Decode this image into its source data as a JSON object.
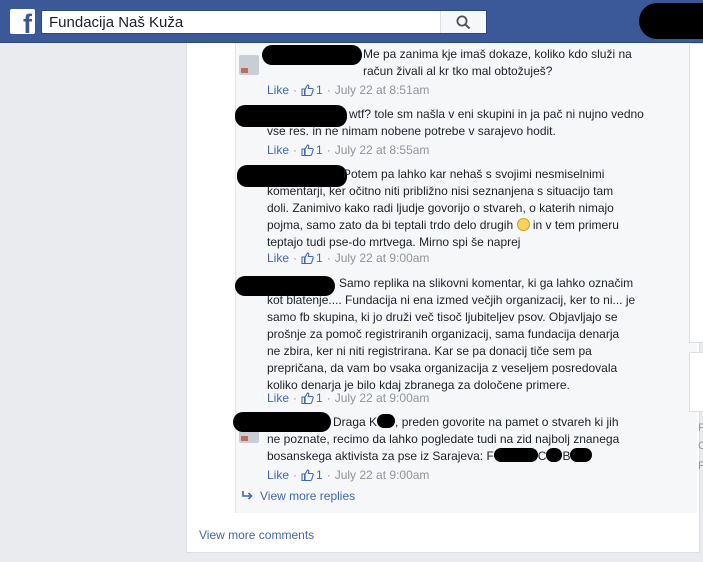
{
  "header": {
    "logo": "f",
    "search_value": "Fundacija Naš Kuža",
    "search_icon": "search-icon"
  },
  "comments": [
    {
      "lines": [
        "Me pa zanima kje imaš dokaze, koliko kdo služi na",
        "račun živali al kr tko mal obtožuješ?"
      ],
      "like_label": "Like",
      "like_count": "1",
      "date": "July 22 at 8:51am"
    },
    {
      "lines": [
        "wtf? tole sm našla v eni skupini in ja pač ni nujno vedno",
        "vse res. in ne nimam nobene potrebe v sarajevo hodit."
      ],
      "like_label": "Like",
      "like_count": "1",
      "date": "July 22 at 8:55am"
    },
    {
      "lines": [
        "Potem pa lahko kar nehaš s svojimi nesmiselnimi",
        "komentarji, ker očitno niti približno nisi seznanjena s situacijo tam",
        "doli. Zanimivo kako radi ljudje govorijo o stvareh, o katerih nimajo",
        "pojma, samo zato da bi teptali trdo delo drugih",
        "in v tem primeru",
        "teptajo tudi pse-do mrtvega. Mirno spi še naprej"
      ],
      "like_label": "Like",
      "like_count": "1",
      "date": "July 22 at 9:00am"
    },
    {
      "lines": [
        "Samo replika na slikovni komentar, ki ga lahko označim",
        "kot blatenje.... Fundacija ni ena izmed večjih organizacij, ker to ni... je",
        "samo fb skupina, ki jo druži več tisoč ljubiteljev psov. Objavljajo se",
        "prošnje za pomoč registriranih organizacij, sama fundacija denarja",
        "ne zbira, ker ni niti registrirana. Kar se pa donacij tiče sem pa",
        "prepričana, da vam bo vsaka organizacija z veseljem posredovala",
        "koliko denarja je bilo kdaj zbranega za določene primere."
      ],
      "like_label": "Like",
      "like_count": "1",
      "date": "July 22 at 9:00am"
    },
    {
      "lines": [
        "Draga K",
        ", preden govorite na pamet o stvareh ki jih",
        "ne poznate, recimo da lahko pogledate tudi na zid najbolj znanega",
        "bosanskega aktivista za pse iz Sarajeva: F",
        "C",
        "B"
      ],
      "like_label": "Like",
      "like_count": "1",
      "date": "July 22 at 9:00am"
    }
  ],
  "view_more_replies": "View more replies",
  "view_more_comments": "View more comments",
  "right_column": [
    "F",
    "C",
    "F"
  ],
  "colors": {
    "brand": "#3b5998",
    "link": "#4267b2",
    "meta": "#90949c"
  }
}
